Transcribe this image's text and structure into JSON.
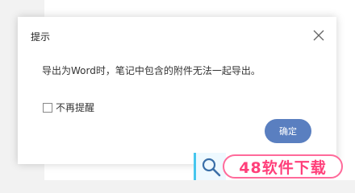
{
  "dialog": {
    "title": "提示",
    "message": "导出为Word时，笔记中包含的附件无法一起导出。",
    "checkbox_label": "不再提醒",
    "ok_label": "确定"
  },
  "watermark": {
    "text": "48软件下载"
  },
  "colors": {
    "ok_button": "#5a7fc0",
    "watermark_pink": "#ff3f7a",
    "watermark_blue": "#45c6ee"
  }
}
